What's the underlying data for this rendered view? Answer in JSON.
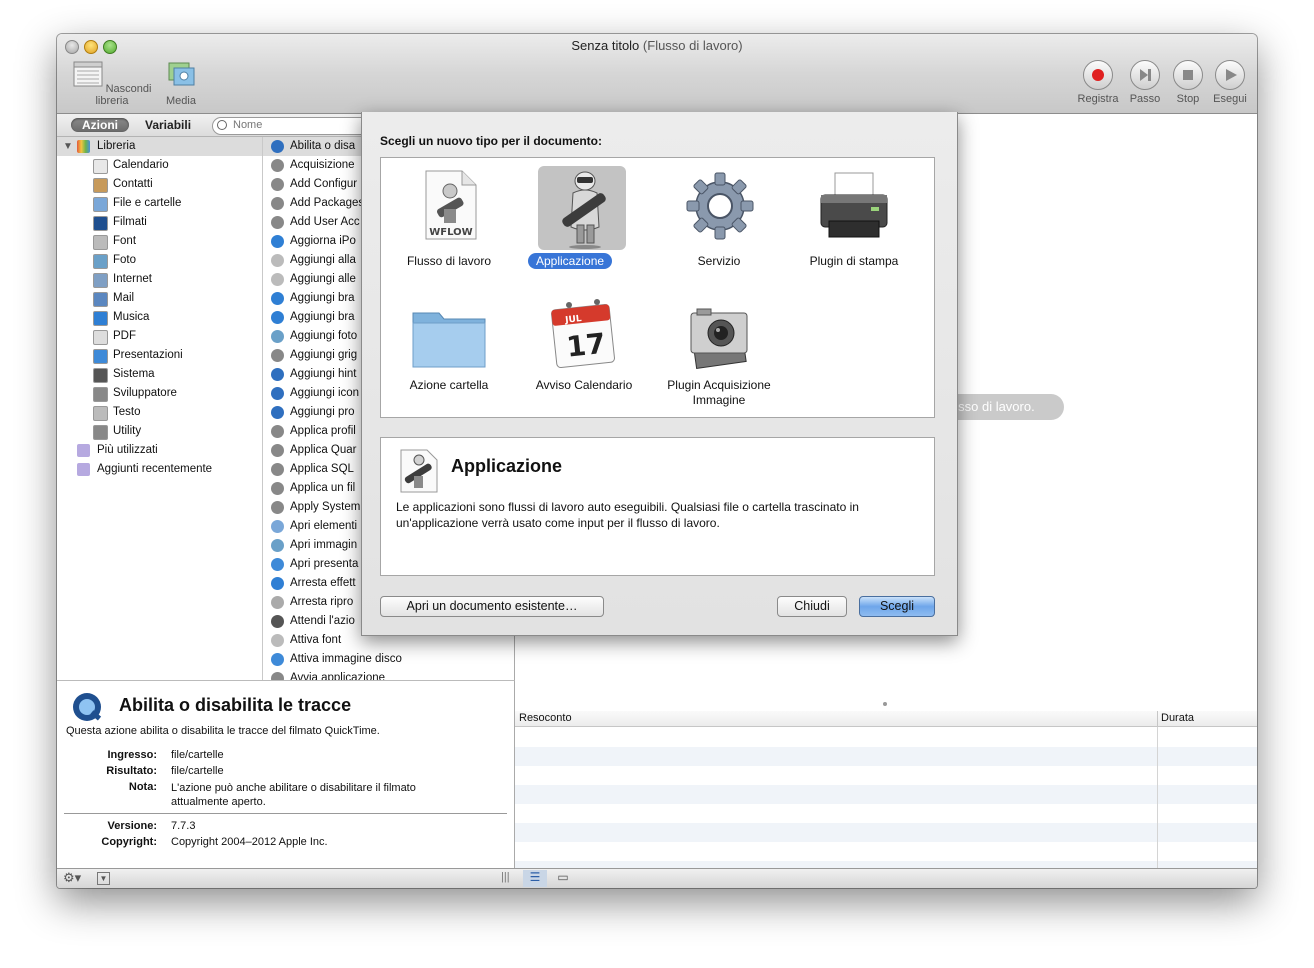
{
  "window": {
    "title_main": "Senza titolo",
    "title_sub": "(Flusso di lavoro)"
  },
  "toolbar": {
    "hide_library": "Nascondi libreria",
    "media": "Media",
    "record": "Registra",
    "step": "Passo",
    "stop": "Stop",
    "run": "Esegui"
  },
  "tabs": {
    "actions": "Azioni",
    "variables": "Variabili"
  },
  "search": {
    "placeholder": "Nome"
  },
  "library": {
    "root": "Libreria",
    "items": [
      "Calendario",
      "Contatti",
      "File e cartelle",
      "Filmati",
      "Font",
      "Foto",
      "Internet",
      "Mail",
      "Musica",
      "PDF",
      "Presentazioni",
      "Sistema",
      "Sviluppatore",
      "Testo",
      "Utility"
    ],
    "most_used": "Più utilizzati",
    "recent": "Aggiunti recentemente"
  },
  "actions": [
    "Abilita o disa",
    "Acquisizione",
    "Add Configur",
    "Add Packages",
    "Add User Acc",
    "Aggiorna iPo",
    "Aggiungi alla",
    "Aggiungi alle",
    "Aggiungi bra",
    "Aggiungi bra",
    "Aggiungi foto",
    "Aggiungi grig",
    "Aggiungi hint",
    "Aggiungi icon",
    "Aggiungi pro",
    "Applica profil",
    "Applica Quar",
    "Applica SQL",
    "Applica un fil",
    "Apply System",
    "Apri elementi",
    "Apri immagin",
    "Apri presenta",
    "Arresta effett",
    "Arresta ripro",
    "Attendi l'azio",
    "Attiva font",
    "Attiva immagine disco",
    "Avvia applicazione"
  ],
  "info": {
    "title": "Abilita o disabilita le tracce",
    "description": "Questa azione abilita o disabilita le tracce del filmato QuickTime.",
    "input_label": "Ingresso:",
    "input_value": "file/cartelle",
    "result_label": "Risultato:",
    "result_value": "file/cartelle",
    "note_label": "Nota:",
    "note_value": "L'azione può anche abilitare o disabilitare il filmato attualmente aperto.",
    "version_label": "Versione:",
    "version_value": "7.7.3",
    "copyright_label": "Copyright:",
    "copyright_value": "Copyright 2004–2012 Apple Inc."
  },
  "workflow_hint": "il flusso di lavoro.",
  "log": {
    "col_report": "Resoconto",
    "col_duration": "Durata"
  },
  "sheet": {
    "prompt": "Scegli un nuovo tipo per il documento:",
    "types": [
      {
        "label": "Flusso di lavoro",
        "icon": "wflow-document-icon"
      },
      {
        "label": "Applicazione",
        "icon": "automator-robot-icon",
        "selected": true
      },
      {
        "label": "Servizio",
        "icon": "gear-icon"
      },
      {
        "label": "Plugin di stampa",
        "icon": "printer-icon"
      },
      {
        "label": "Azione cartella",
        "icon": "folder-icon"
      },
      {
        "label": "Avviso Calendario",
        "icon": "calendar-icon"
      },
      {
        "label": "Plugin Acquisizione Immagine",
        "icon": "camera-icon"
      }
    ],
    "wflow_badge": "WFLOW",
    "cal_month": "JUL",
    "cal_day": "17",
    "selected_title": "Applicazione",
    "selected_desc": "Le applicazioni sono flussi di lavoro auto eseguibili. Qualsiasi file o cartella trascinato in un'applicazione verrà usato come input per il flusso di lavoro.",
    "open_existing": "Apri un documento esistente…",
    "close": "Chiudi",
    "choose": "Scegli"
  },
  "colors": {
    "selection": "#3875d7",
    "record_red": "#e02020"
  }
}
